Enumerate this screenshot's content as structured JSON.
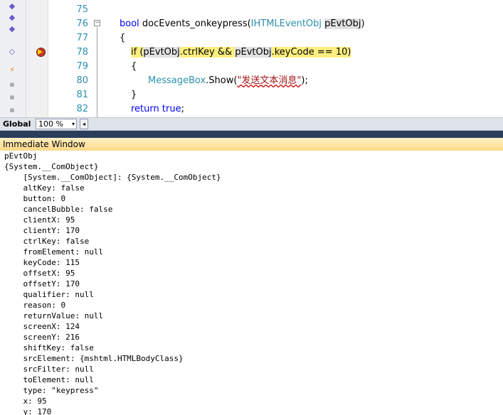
{
  "editor": {
    "line_numbers": [
      "75",
      "76",
      "77",
      "78",
      "79",
      "80",
      "81",
      "82"
    ],
    "code": {
      "l76_kw": "bool",
      "l76_fn": " docEvents_onkeypress(",
      "l76_type": "IHTMLEventObj",
      "l76_param": "pEvtObj",
      "l76_close": ")",
      "l77": "{",
      "l78_if": "if",
      "l78_open": " (",
      "l78_var1": "pEvtObj",
      "l78_mid": ".ctrlKey && ",
      "l78_var2": "pEvtObj",
      "l78_end": ".keyCode == 10)",
      "l79": "{",
      "l80_type": "MessageBox",
      "l80_call": ".Show(",
      "l80_str": "\"发送文本消息\"",
      "l80_end": ");",
      "l81": "}",
      "l82_kw": "return",
      "l82_val": " true",
      "l82_end": ";"
    }
  },
  "zoom_bar": {
    "scope": "Global",
    "zoom": "100 %",
    "caret": "▾",
    "scroll_left": "◂"
  },
  "immediate_window": {
    "title": "Immediate Window",
    "lines": [
      "pEvtObj",
      "{System.__ComObject}",
      "    [System.__ComObject]: {System.__ComObject}",
      "    altKey: false",
      "    button: 0",
      "    cancelBubble: false",
      "    clientX: 95",
      "    clientY: 170",
      "    ctrlKey: false",
      "    fromElement: null",
      "    keyCode: 115",
      "    offsetX: 95",
      "    offsetY: 170",
      "    qualifier: null",
      "    reason: 0",
      "    returnValue: null",
      "    screenX: 124",
      "    screenY: 216",
      "    shiftKey: false",
      "    srcElement: {mshtml.HTMLBodyClass}",
      "    srcFilter: null",
      "    toElement: null",
      "    type: \"keypress\"",
      "    x: 95",
      "    y: 170"
    ]
  },
  "colors": {
    "keyword": "#0000ff",
    "type": "#2b91af",
    "string": "#a31515",
    "current_line": "#ffef80",
    "window_header": "#ffd98a"
  }
}
